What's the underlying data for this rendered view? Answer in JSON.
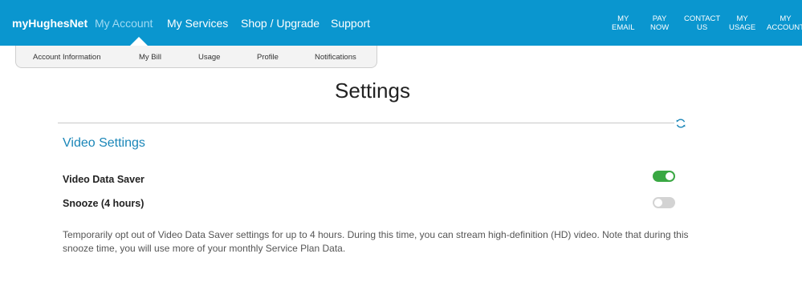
{
  "header": {
    "brand": "myHughesNet",
    "nav": [
      {
        "label": "My Account",
        "active": true
      },
      {
        "label": "My Services",
        "active": false
      },
      {
        "label": "Shop / Upgrade",
        "active": false
      },
      {
        "label": "Support",
        "active": false
      }
    ],
    "right_links": [
      {
        "line1": "MY",
        "line2": "EMAIL"
      },
      {
        "line1": "PAY",
        "line2": "NOW"
      },
      {
        "line1": "CONTACT",
        "line2": "US"
      },
      {
        "line1": "MY",
        "line2": "USAGE"
      },
      {
        "line1": "MY",
        "line2": "ACCOUNT"
      }
    ],
    "bar_color": "#0a96cf",
    "active_color": "#9fdaf3"
  },
  "subnav": [
    "Account Information",
    "My Bill",
    "Usage",
    "Profile",
    "Notifications"
  ],
  "main": {
    "title": "Settings",
    "refresh_icon": "refresh-icon",
    "section_title": "Video Settings",
    "settings": [
      {
        "label": "Video Data Saver",
        "enabled": true
      },
      {
        "label": "Snooze (4 hours)",
        "enabled": false
      }
    ],
    "description": "Temporarily opt out of Video Data Saver settings for up to 4 hours. During this time, you can stream high-definition (HD) video. Note that during this snooze time, you will use more of your monthly Service Plan Data."
  },
  "colors": {
    "toggle_on": "#3aa843",
    "toggle_off": "#d3d3d3",
    "section_title": "#1a86b8"
  }
}
